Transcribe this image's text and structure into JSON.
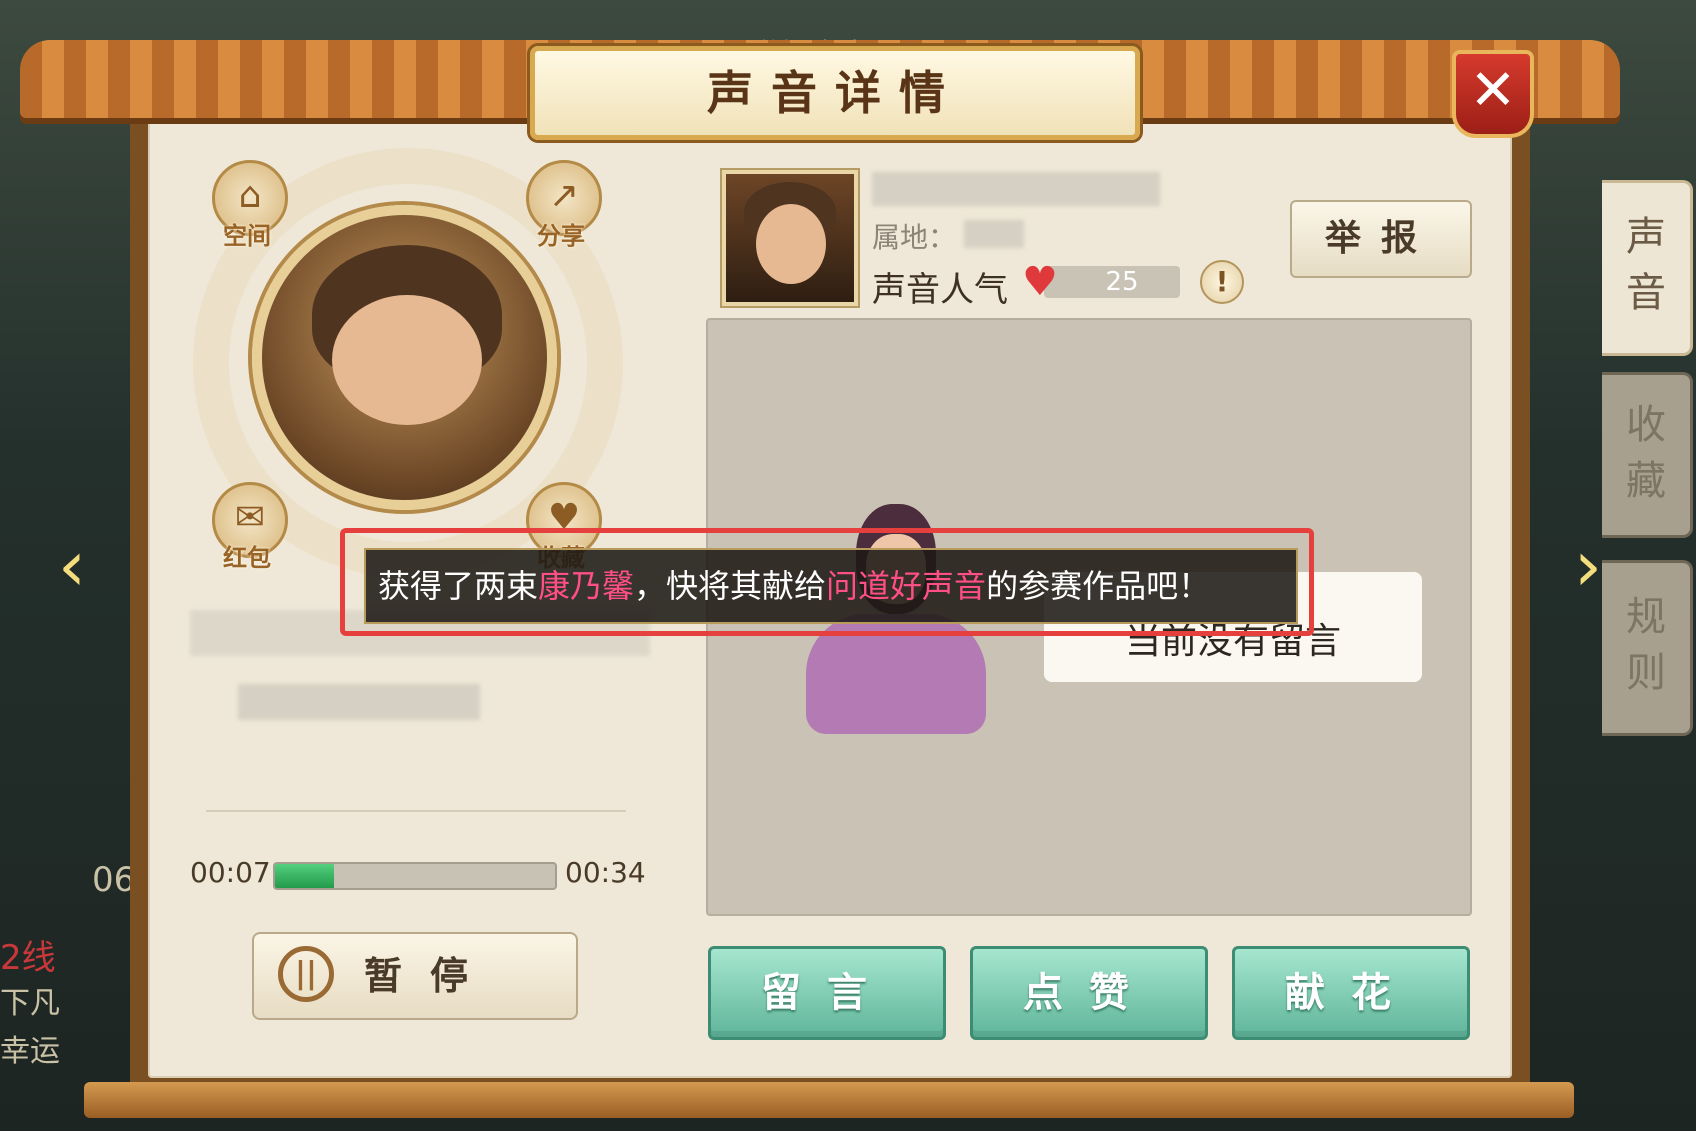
{
  "title": "声音详情",
  "close_icon": "✕",
  "background": {
    "top_faded_title": "问道好声音",
    "left_time": "06",
    "left_line": "2线",
    "left_word1": "下凡",
    "left_word2": "幸运"
  },
  "side_tabs": [
    {
      "label": "声\n音",
      "active": true
    },
    {
      "label": "收\n藏",
      "active": false
    },
    {
      "label": "规\n则",
      "active": false
    }
  ],
  "left_panel": {
    "buttons": [
      {
        "label": "空间",
        "icon": "home-icon"
      },
      {
        "label": "分享",
        "icon": "share-icon"
      },
      {
        "label": "红包",
        "icon": "red-envelope-icon"
      },
      {
        "label": "收藏",
        "icon": "heart-icon"
      }
    ],
    "time_current": "00:07",
    "time_total": "00:34",
    "progress": 0.21,
    "pause_label": "暂停"
  },
  "right_panel": {
    "region_label": "属地：",
    "popularity_label": "声音人气",
    "popularity_value": "25",
    "info_icon": "!",
    "report_label": "举报",
    "empty_message": "当前没有留言"
  },
  "actions": {
    "comment": "留言",
    "like": "点赞",
    "flower": "献花"
  },
  "notice": {
    "part1": "获得了两束",
    "highlight1": "康乃馨",
    "part2": "，快将其献给",
    "highlight2": "问道好声音",
    "part3": "的参赛作品吧！"
  },
  "colors": {
    "accent_pink": "#ff4f86",
    "highlight_red": "#e6403e",
    "progress_green": "#2fae55",
    "action_green": "#5fb59a"
  }
}
